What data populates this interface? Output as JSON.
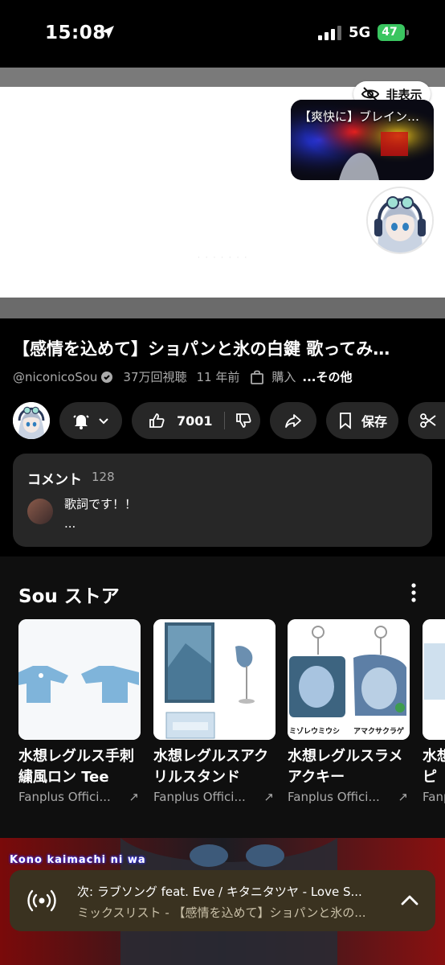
{
  "status_bar": {
    "time": "15:08",
    "network": "5G",
    "battery": "47"
  },
  "player": {
    "hide_label": "非表示",
    "mini_video_title": "【爽快に】ブレイン…"
  },
  "video": {
    "title": "【感情を込めて】ショパンと氷の白鍵 歌ってみ…",
    "channel": "@niconicoSou",
    "views": "37万回視聴",
    "age": "11 年前",
    "purchase_label": "購入",
    "more_label": "...その他"
  },
  "actions": {
    "likes": "7001",
    "save_label": "保存"
  },
  "comments": {
    "header": "コメント",
    "count": "128",
    "top_comment": "歌詞です！！",
    "top_comment_more": "..."
  },
  "store": {
    "title": "Sou ストア",
    "items": [
      {
        "name": "水想レグルス手刺繍風ロン Tee",
        "seller": "Fanplus Offici..."
      },
      {
        "name": "水想レグルスアクリルスタンド",
        "seller": "Fanplus Offici..."
      },
      {
        "name": "水想レグルスラメアクキー",
        "seller": "Fanplus Offici...",
        "labels": [
          "ミゾレウミウシ",
          "アマクサクラゲ"
        ]
      },
      {
        "name": "水想レグルスス ッピ",
        "seller": "Fanplu"
      }
    ]
  },
  "lyrics_overlay": "Kono kaimachi ni wa",
  "next_up": {
    "line1": "次: ラブソング feat. Eve / キタニタツヤ - Love S...",
    "line2": "ミックスリスト - 【感情を込めて】ショパンと氷の..."
  }
}
